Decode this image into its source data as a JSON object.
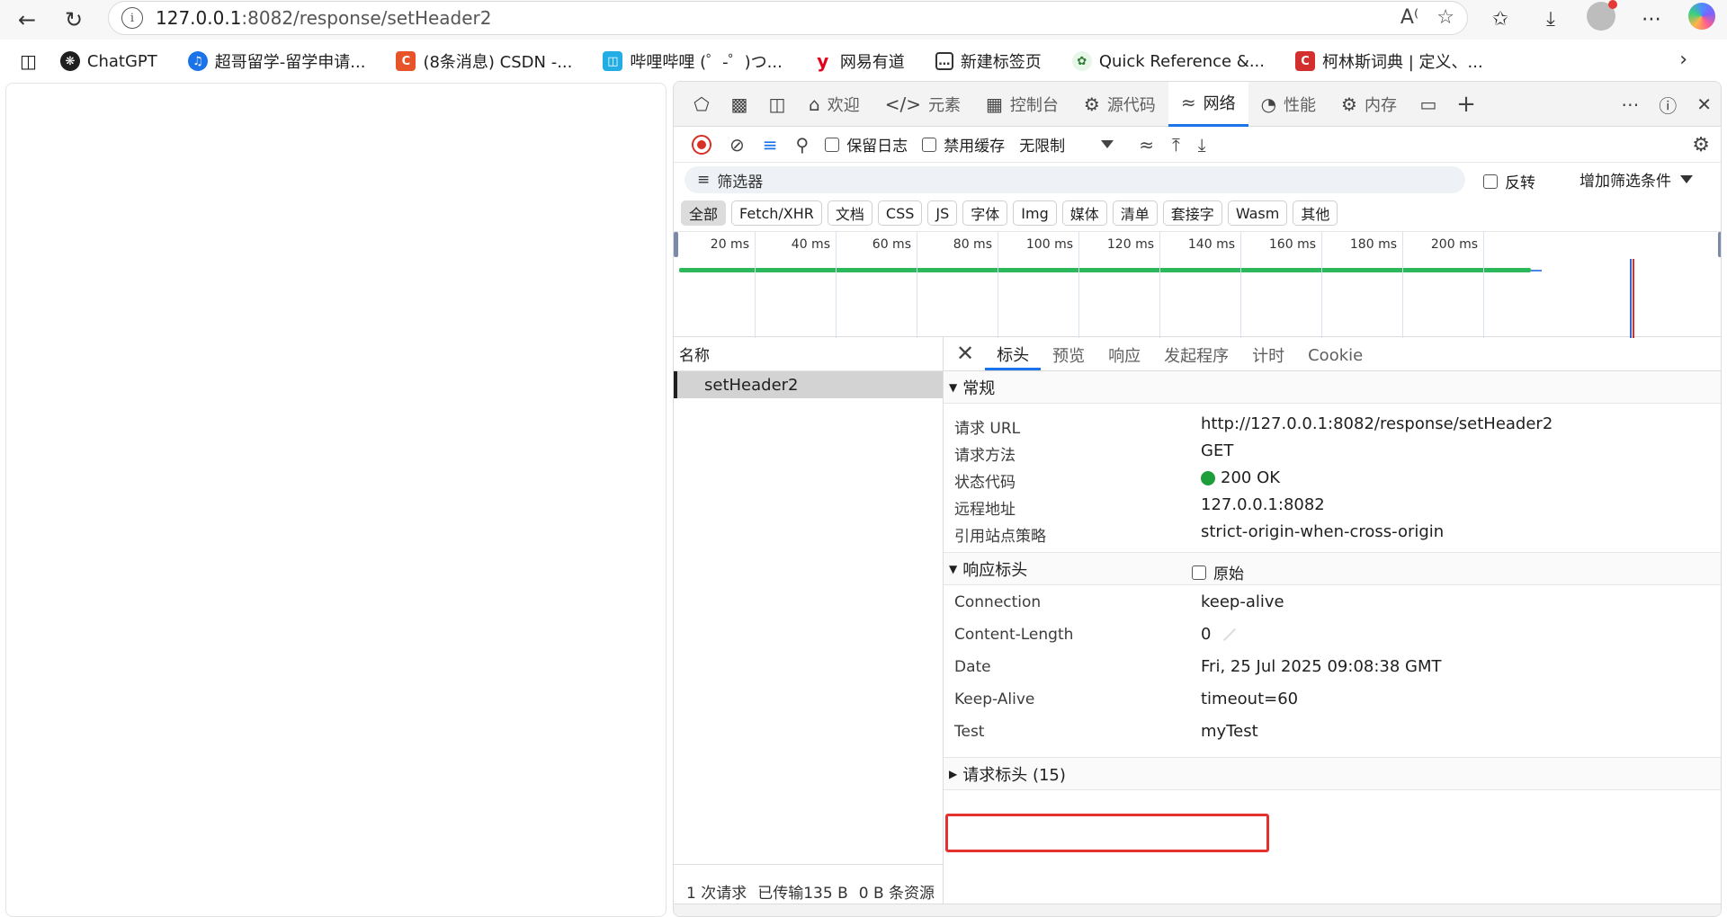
{
  "browser": {
    "url_host": "127.0.0.1",
    "url_rest": ":8082/response/setHeader2",
    "info_glyph": "i"
  },
  "bookmarks": [
    {
      "label": "ChatGPT",
      "icon": "chatgpt-icon",
      "color": "#1f1f1f"
    },
    {
      "label": "超哥留学-留学申请...",
      "icon": "globe-icon",
      "color": "#1a73e8"
    },
    {
      "label": "(8条消息) CSDN -...",
      "icon": "csdn-icon",
      "color": "#e8542a"
    },
    {
      "label": "哔哩哔哩 (゜-゜)つ...",
      "icon": "bilibili-icon",
      "color": "#23ade5"
    },
    {
      "label": "网易有道",
      "icon": "youdao-icon",
      "color": "#e3001b"
    },
    {
      "label": "新建标签页",
      "icon": "newtab-icon",
      "color": "#333333"
    },
    {
      "label": "Quick Reference &...",
      "icon": "leaf-icon",
      "color": "#2e7d32"
    },
    {
      "label": "柯林斯词典 | 定义、...",
      "icon": "collins-icon",
      "color": "#d32f2f"
    }
  ],
  "devtools": {
    "tabs": [
      {
        "label": "欢迎",
        "icon": "home-icon",
        "active": false
      },
      {
        "label": "元素",
        "icon": "code-icon",
        "active": false
      },
      {
        "label": "控制台",
        "icon": "console-icon",
        "active": false
      },
      {
        "label": "源代码",
        "icon": "bug-icon",
        "active": false
      },
      {
        "label": "网络",
        "icon": "wifi-icon",
        "active": true
      },
      {
        "label": "性能",
        "icon": "gauge-icon",
        "active": false
      },
      {
        "label": "内存",
        "icon": "gear-chip-icon",
        "active": false
      }
    ],
    "toolbar": {
      "preserve_log": "保留日志",
      "disable_cache": "禁用缓存",
      "throttle": "无限制"
    },
    "filter": {
      "placeholder": "筛选器",
      "invert": "反转",
      "more_filters": "增加筛选条件"
    },
    "types": [
      "全部",
      "Fetch/XHR",
      "文档",
      "CSS",
      "JS",
      "字体",
      "Img",
      "媒体",
      "清单",
      "套接字",
      "Wasm",
      "其他"
    ],
    "timeline_ticks": [
      "20 ms",
      "40 ms",
      "60 ms",
      "80 ms",
      "100 ms",
      "120 ms",
      "140 ms",
      "160 ms",
      "180 ms",
      "200 ms"
    ],
    "request_list": {
      "header": "名称",
      "rows": [
        "setHeader2"
      ],
      "status": {
        "requests": "1 次请求",
        "transferred": "已传输135 B",
        "resources": "0 B 条资源"
      }
    },
    "details": {
      "tabs": [
        "标头",
        "预览",
        "响应",
        "发起程序",
        "计时",
        "Cookie"
      ],
      "general": {
        "title": "常规",
        "rows": [
          {
            "key": "请求 URL",
            "value": "http://127.0.0.1:8082/response/setHeader2"
          },
          {
            "key": "请求方法",
            "value": "GET"
          },
          {
            "key": "状态代码",
            "value": "200 OK"
          },
          {
            "key": "远程地址",
            "value": "127.0.0.1:8082"
          },
          {
            "key": "引用站点策略",
            "value": "strict-origin-when-cross-origin"
          }
        ]
      },
      "response_headers": {
        "title": "响应标头",
        "raw_label": "原始",
        "rows": [
          {
            "key": "Connection",
            "value": "keep-alive"
          },
          {
            "key": "Content-Length",
            "value": "0"
          },
          {
            "key": "Date",
            "value": "Fri, 25 Jul 2025 09:08:38 GMT"
          },
          {
            "key": "Keep-Alive",
            "value": "timeout=60"
          },
          {
            "key": "Test",
            "value": "myTest"
          }
        ]
      },
      "request_headers": {
        "title": "请求标头 (15)"
      }
    }
  },
  "colors": {
    "accent": "#1a73e8",
    "status_ok": "#1e9e3a",
    "highlight": "#e53030",
    "record": "#d93025"
  }
}
